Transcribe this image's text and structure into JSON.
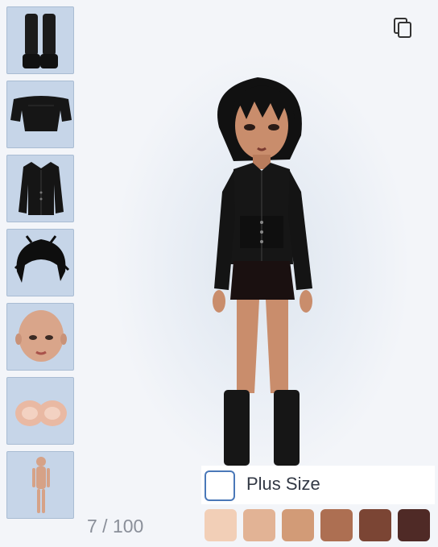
{
  "sidebar": {
    "items": [
      {
        "label": "",
        "icon": "boots-icon"
      },
      {
        "label": "",
        "icon": "off-shoulder-top-icon"
      },
      {
        "label": "",
        "icon": "jacket-icon"
      },
      {
        "label": "",
        "icon": "hair-icon"
      },
      {
        "label": "",
        "icon": "face-icon"
      },
      {
        "label": "",
        "icon": "chest-icon"
      },
      {
        "label": "",
        "icon": "body-icon"
      }
    ]
  },
  "pagination": {
    "text": "7 / 100"
  },
  "toolbar": {
    "copy_icon": "copy-icon"
  },
  "plus_size": {
    "label": "Plus Size",
    "checked": false
  },
  "skin_tones": {
    "colors": [
      "#f2cfb7",
      "#e2b395",
      "#d29b77",
      "#ad6f52",
      "#7b4534",
      "#4f2a26"
    ]
  },
  "colors": {
    "slot_bg": "#c6d5e8",
    "checkbox_border": "#4a78b8",
    "hair": "#111111",
    "clothing": "#161616",
    "skin": "#c98d6c"
  }
}
